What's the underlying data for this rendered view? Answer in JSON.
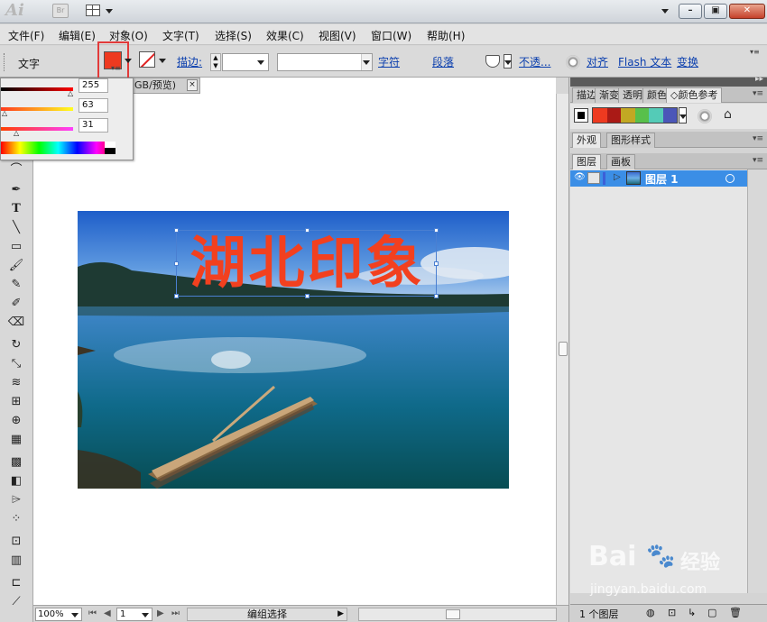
{
  "titlebar": {
    "app_logo": "Ai",
    "bridge_label": "Br"
  },
  "menu": [
    "文件(F)",
    "编辑(E)",
    "对象(O)",
    "文字(T)",
    "选择(S)",
    "效果(C)",
    "视图(V)",
    "窗口(W)",
    "帮助(H)"
  ],
  "control_bar": {
    "mode_label": "文字",
    "fill_color": "#ee3a20",
    "stroke_label": "描边:",
    "char_link": "字符",
    "para_link": "段落",
    "opacity_link": "不透...",
    "align_link": "对齐",
    "flash_link": "Flash 文本",
    "transform_link": "变换"
  },
  "color_popup": {
    "r_value": "255",
    "g_value": "63",
    "b_value": "31"
  },
  "document": {
    "tab_label": "GB/预览)",
    "tab_close": "×",
    "artwork_text": "湖北印象",
    "text_color": "#f2401f"
  },
  "statusbar": {
    "zoom": "100%",
    "artboard": "1",
    "status": "编组选择"
  },
  "panels": {
    "top_tabs": [
      "描边",
      "渐变",
      "透明",
      "颜色",
      "颜色参考"
    ],
    "appearance_tabs": [
      "外观",
      "图形样式"
    ],
    "layer_tabs": [
      "图层",
      "画板"
    ],
    "layer_name": "图层 1",
    "layers_count": "1 个图层",
    "swatches": [
      "#ee3a20",
      "#aa1a16",
      "#c2a823",
      "#58c04b",
      "#54cbb7",
      "#4b56b8"
    ]
  },
  "watermark": {
    "brand": "Bai",
    "brand2": "经验",
    "url": "jingyan.baidu.com"
  }
}
